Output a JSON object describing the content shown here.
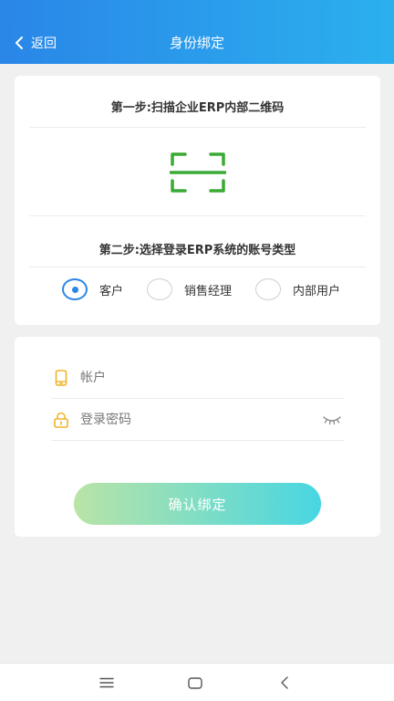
{
  "header": {
    "back_label": "返回",
    "title": "身份绑定"
  },
  "scan_card": {
    "step1": "第一步:扫描企业ERP内部二维码",
    "step2": "第二步:选择登录ERP系统的账号类型",
    "account_types": [
      {
        "label": "客户",
        "checked": true
      },
      {
        "label": "销售经理",
        "checked": false
      },
      {
        "label": "内部用户",
        "checked": false
      }
    ]
  },
  "login_form": {
    "account_placeholder": "帐户",
    "password_placeholder": "登录密码",
    "confirm_label": "确认绑定"
  },
  "colors": {
    "header_start": "#2a86e8",
    "header_end": "#2bb0ee",
    "scan_green": "#3aaa35",
    "field_icon": "#f0b429",
    "radio_accent": "#2a86e8"
  }
}
